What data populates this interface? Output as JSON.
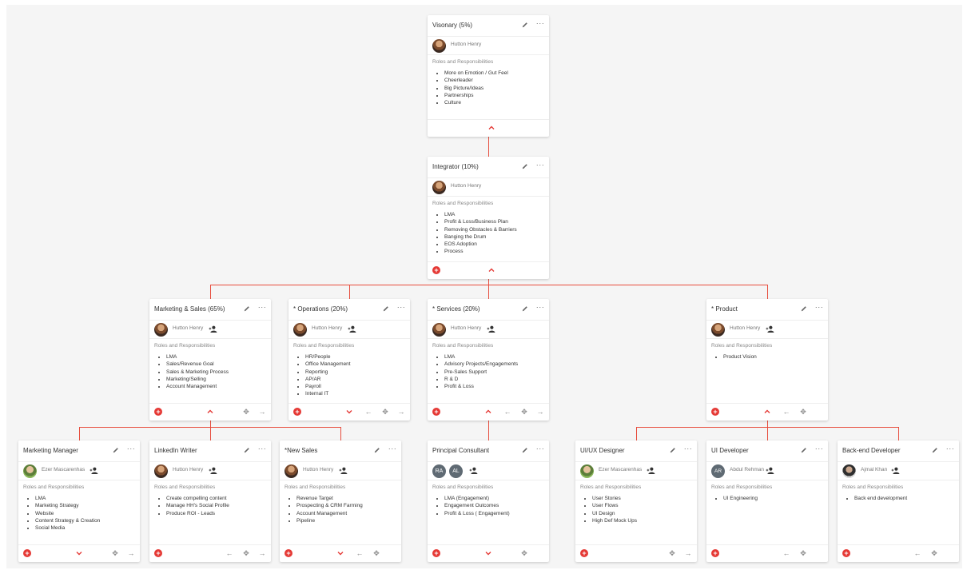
{
  "colors": {
    "accent": "#e53935",
    "connector": "#e74c3c",
    "background": "#f5f5f5"
  },
  "icons": {
    "edit": "pencil-icon",
    "more": "ellipsis-icon",
    "add": "plus-circle-icon",
    "collapse": "chevron-up-icon",
    "expand": "chevron-down-icon",
    "move": "move-icon",
    "left": "arrow-left-icon",
    "right": "arrow-right-icon",
    "assign": "add-person-icon"
  },
  "common": {
    "roles_title": "Roles and Responsibilities",
    "more": "···",
    "add": "+",
    "move": "✥",
    "left": "←",
    "right": "→"
  },
  "seats": [
    {
      "id": "visionary",
      "title": "Visonary (5%)",
      "owner": "Hutton Henry",
      "roles": [
        "More on Emotion / Gut Feel",
        "Cheerleader",
        "Big Picture/Ideas",
        "Partnerships",
        "Culture"
      ]
    },
    {
      "id": "integrator",
      "title": "Integrator (10%)",
      "owner": "Hutton Henry",
      "roles": [
        "LMA",
        "Profit & Loss/Business Plan",
        "Removing Obstacles & Barriers",
        "Banging the Drum",
        "EOS Adoption",
        "Process"
      ]
    },
    {
      "id": "marketing-sales",
      "title": "Marketing & Sales (65%)",
      "owner": "Hutton Henry",
      "roles": [
        "LMA",
        "Sales/Revenue Goal",
        "Sales & Marketing Process",
        "Marketing/Selling",
        "Account Management"
      ]
    },
    {
      "id": "operations",
      "title": "* Operations (20%)",
      "owner": "Hutton Henry",
      "roles": [
        "HR/People",
        "Office Management",
        "Reporting",
        "AP/AR",
        "Payroll",
        "Internal IT"
      ]
    },
    {
      "id": "services",
      "title": "* Services (20%)",
      "owner": "Hutton Henry",
      "roles": [
        "LMA",
        "Advisory Projects/Engagements",
        "Pre-Sales Support",
        "R & D",
        "Profit & Loss"
      ]
    },
    {
      "id": "product",
      "title": "* Product",
      "owner": "Hutton Henry",
      "roles": [
        "Product Vision"
      ]
    },
    {
      "id": "marketing-manager",
      "title": "Marketing Manager",
      "owner": "Ezer Mascarenhas",
      "roles": [
        "LMA",
        "Marketing Strategy",
        "Website",
        "Content Strategy & Creation",
        "Social Media"
      ]
    },
    {
      "id": "linkedin-writer",
      "title": "LinkedIn Writer",
      "owner": "Hutton Henry",
      "roles": [
        "Create compelling content",
        "Manage HH's Social Profile",
        "Produce ROI - Leads"
      ]
    },
    {
      "id": "new-sales",
      "title": "*New Sales",
      "owner": "Hutton Henry",
      "roles": [
        "Revenue Target",
        "Prospecting & CRM Farming",
        "Account Management",
        "Pipeline"
      ]
    },
    {
      "id": "principal-consultant",
      "title": "Principal Consultant",
      "owner": "",
      "avatars": [
        "RA",
        "AL"
      ],
      "roles": [
        "LMA (Engagement)",
        "Engagement Outcomes",
        "Profit & Loss ( Engagement)"
      ]
    },
    {
      "id": "uiux-designer",
      "title": "UI/UX Designer",
      "owner": "Ezer Mascarenhas",
      "roles": [
        "User Stories",
        "User Flows",
        "UI Design",
        "High Def Mock Ups"
      ]
    },
    {
      "id": "ui-developer",
      "title": "UI Developer",
      "owner": "Abdul Rehman",
      "avatar_initials": "AR",
      "roles": [
        "UI Engineering"
      ]
    },
    {
      "id": "backend-developer",
      "title": "Back-end Developer",
      "owner": "Ajmal Khan",
      "roles": [
        "Back end development"
      ]
    }
  ]
}
